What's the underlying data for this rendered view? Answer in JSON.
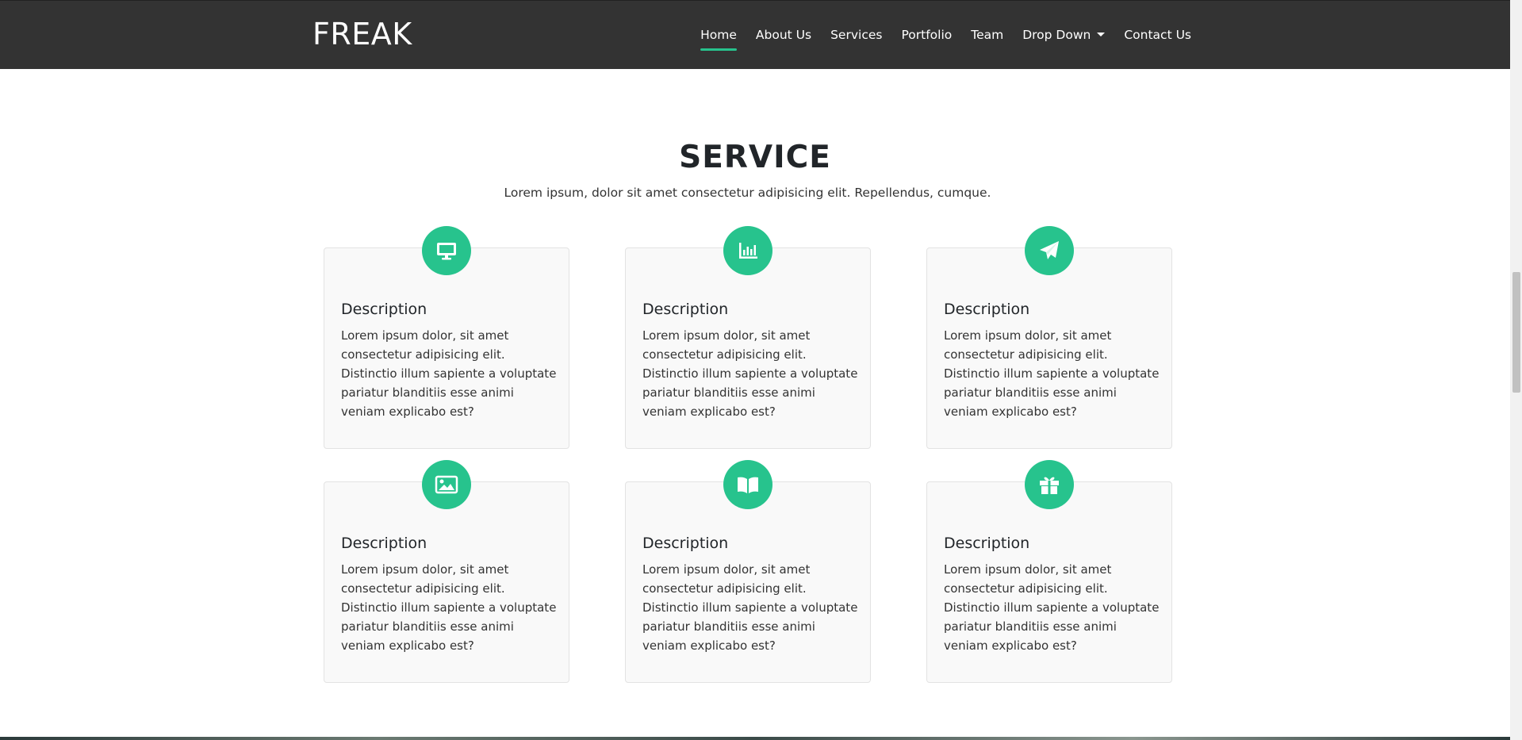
{
  "brand": "FREAK",
  "nav": {
    "items": [
      {
        "label": "Home"
      },
      {
        "label": "About Us"
      },
      {
        "label": "Services"
      },
      {
        "label": "Portfolio"
      },
      {
        "label": "Team"
      },
      {
        "label": "Drop Down"
      },
      {
        "label": "Contact Us"
      }
    ],
    "active": "Home"
  },
  "service": {
    "title": "SERVICE",
    "subtitle": "Lorem ipsum, dolor sit amet consectetur adipisicing elit. Repellendus, cumque.",
    "cards": [
      {
        "icon": "desktop-icon",
        "title": "Description",
        "text": "Lorem ipsum dolor, sit amet consectetur adipisicing elit. Distinctio illum sapiente a voluptate pariatur blanditiis esse animi veniam explicabo est?"
      },
      {
        "icon": "bar-chart-icon",
        "title": "Description",
        "text": "Lorem ipsum dolor, sit amet consectetur adipisicing elit. Distinctio illum sapiente a voluptate pariatur blanditiis esse animi veniam explicabo est?"
      },
      {
        "icon": "paper-plane-icon",
        "title": "Description",
        "text": "Lorem ipsum dolor, sit amet consectetur adipisicing elit. Distinctio illum sapiente a voluptate pariatur blanditiis esse animi veniam explicabo est?"
      },
      {
        "icon": "image-icon",
        "title": "Description",
        "text": "Lorem ipsum dolor, sit amet consectetur adipisicing elit. Distinctio illum sapiente a voluptate pariatur blanditiis esse animi veniam explicabo est?"
      },
      {
        "icon": "book-open-icon",
        "title": "Description",
        "text": "Lorem ipsum dolor, sit amet consectetur adipisicing elit. Distinctio illum sapiente a voluptate pariatur blanditiis esse animi veniam explicabo est?"
      },
      {
        "icon": "gift-icon",
        "title": "Description",
        "text": "Lorem ipsum dolor, sit amet consectetur adipisicing elit. Distinctio illum sapiente a voluptate pariatur blanditiis esse animi veniam explicabo est?"
      }
    ]
  },
  "colors": {
    "accent": "#27c38d",
    "navbar": "#333333"
  }
}
